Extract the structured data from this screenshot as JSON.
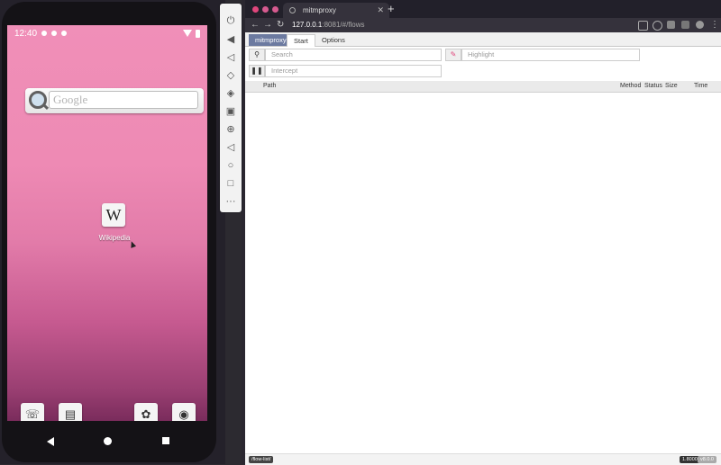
{
  "phone": {
    "status_time": "12:40",
    "search_placeholder": "Google",
    "wiki_icon_glyph": "W",
    "wiki_label": "Wikipedia",
    "dock": [
      "phone-icon",
      "messages-icon",
      "app-icon",
      "camera-icon"
    ]
  },
  "emulator_toolbar": {
    "buttons": [
      "power-icon",
      "volume-up-icon",
      "volume-down-icon",
      "rotate-left-icon",
      "rotate-right-icon",
      "camera-icon",
      "zoom-icon",
      "back-icon",
      "home-icon",
      "overview-icon",
      "more-icon"
    ]
  },
  "browser": {
    "tab_title": "mitmproxy",
    "new_tab": "+",
    "url_host": "127.0.0.1",
    "url_rest": ":8081/#/flows"
  },
  "mitmproxy": {
    "tabs": {
      "brand": "mitmproxy",
      "start": "Start",
      "options": "Options"
    },
    "search_placeholder": "Search",
    "highlight_placeholder": "Highlight",
    "intercept_placeholder": "Intercept",
    "columns": {
      "path": "Path",
      "method": "Method",
      "status": "Status",
      "size": "Size",
      "time": "Time"
    },
    "footer_left": "/flow-list/",
    "footer_right_1": "1.8000",
    "footer_right_2": "v8.0.0"
  },
  "colors": {
    "brand": "#6c7aa0",
    "traffic_red": "#e0467c",
    "traffic_pink": "#d65a8f"
  }
}
